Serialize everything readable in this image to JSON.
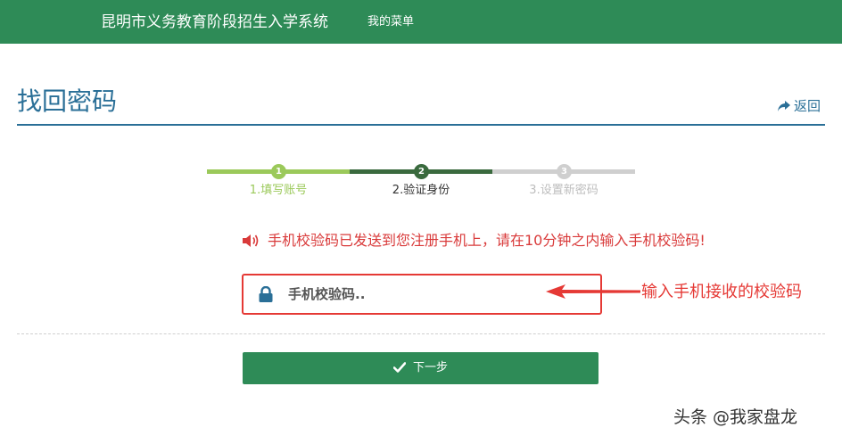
{
  "header": {
    "app_title": "昆明市义务教育阶段招生入学系统",
    "menu_link": "我的菜单"
  },
  "page": {
    "title": "找回密码",
    "back_label": "返回"
  },
  "steps": [
    {
      "number": "1",
      "label": "1.填写账号",
      "state": "completed"
    },
    {
      "number": "2",
      "label": "2.验证身份",
      "state": "current"
    },
    {
      "number": "3",
      "label": "3.设置新密码",
      "state": "pending"
    }
  ],
  "notice": {
    "icon": "speaker-icon",
    "text": "手机校验码已发送到您注册手机上，请在10分钟之内输入手机校验码!"
  },
  "code_field": {
    "icon": "lock-icon",
    "placeholder": "手机校验码..",
    "value": ""
  },
  "annotation": {
    "text": "输入手机接收的校验码"
  },
  "next_button": {
    "icon": "check-icon",
    "label": "下一步"
  },
  "watermark": "头条 @我家盘龙",
  "colors": {
    "brand_green": "#2e8b57",
    "title_blue": "#2a6f97",
    "step_completed": "#9bc95a",
    "step_current": "#3a6a3e",
    "step_pending": "#cfcfcf",
    "notice_red": "#d93a3a",
    "highlight_red": "#e53935"
  }
}
